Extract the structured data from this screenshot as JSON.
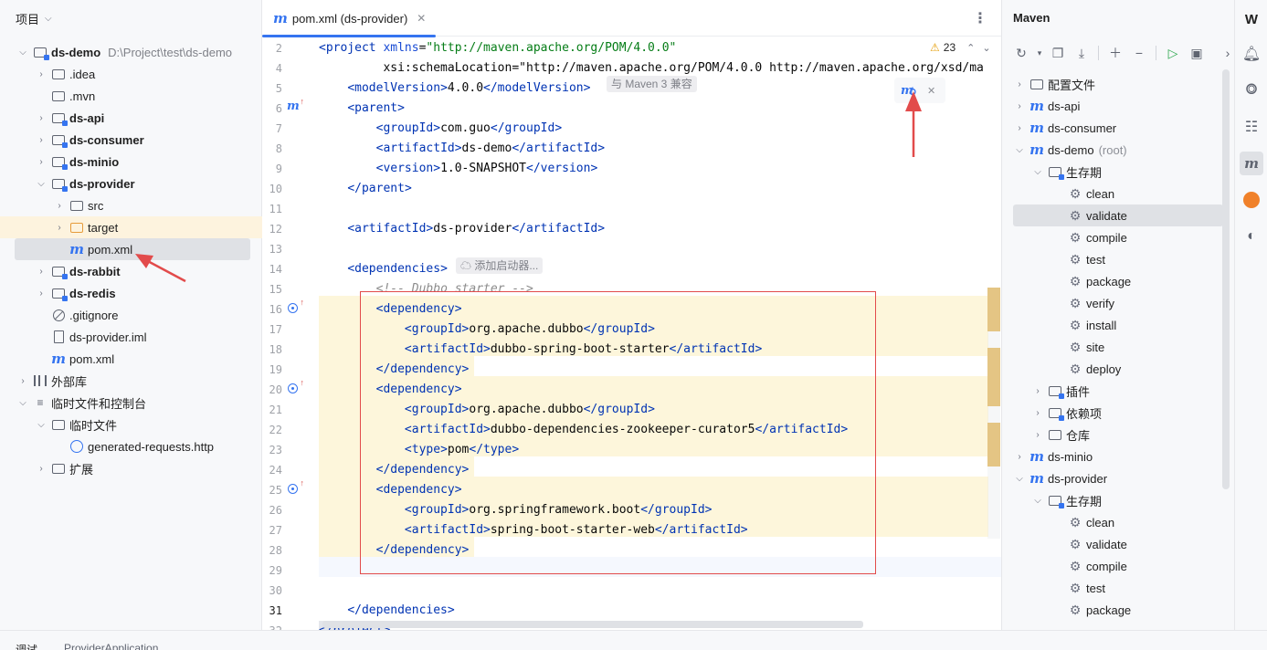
{
  "project_panel": {
    "title": "项目",
    "tree": [
      {
        "label": "ds-demo",
        "path": "D:\\Project\\test\\ds-demo",
        "bold": true,
        "expanded": true
      },
      {
        "label": ".idea"
      },
      {
        "label": ".mvn"
      },
      {
        "label": "ds-api",
        "bold": true
      },
      {
        "label": "ds-consumer",
        "bold": true
      },
      {
        "label": "ds-minio",
        "bold": true
      },
      {
        "label": "ds-provider",
        "bold": true,
        "expanded": true
      },
      {
        "label": "src"
      },
      {
        "label": "target"
      },
      {
        "label": "pom.xml"
      },
      {
        "label": "ds-rabbit",
        "bold": true
      },
      {
        "label": "ds-redis",
        "bold": true
      },
      {
        "label": ".gitignore"
      },
      {
        "label": "ds-provider.iml"
      },
      {
        "label": "pom.xml"
      },
      {
        "label": "外部库"
      },
      {
        "label": "临时文件和控制台"
      },
      {
        "label": "临时文件"
      },
      {
        "label": "generated-requests.http"
      },
      {
        "label": "扩展"
      }
    ]
  },
  "editor": {
    "tab_label": "pom.xml (ds-provider)",
    "warnings": "23",
    "hints": {
      "maven_compat": "与 Maven 3 兼容",
      "add_starter": "添加启动器..."
    },
    "lines": [
      {
        "n": "2",
        "t": "<project xmlns=\"http://maven.apache.org/POM/4.0.0\""
      },
      {
        "n": "4",
        "t": "         xsi:schemaLocation=\"http://maven.apache.org/POM/4.0.0 http://maven.apache.org/xsd/ma"
      },
      {
        "n": "5",
        "t": "    <modelVersion>4.0.0</modelVersion>"
      },
      {
        "n": "6",
        "t": "    <parent>"
      },
      {
        "n": "7",
        "t": "        <groupId>com.guo</groupId>"
      },
      {
        "n": "8",
        "t": "        <artifactId>ds-demo</artifactId>"
      },
      {
        "n": "9",
        "t": "        <version>1.0-SNAPSHOT</version>"
      },
      {
        "n": "10",
        "t": "    </parent>"
      },
      {
        "n": "11",
        "t": ""
      },
      {
        "n": "12",
        "t": "    <artifactId>ds-provider</artifactId>"
      },
      {
        "n": "13",
        "t": ""
      },
      {
        "n": "14",
        "t": "    <dependencies>"
      },
      {
        "n": "15",
        "t": "        <!-- Dubbo starter -->"
      },
      {
        "n": "16",
        "t": "        <dependency>"
      },
      {
        "n": "17",
        "t": "            <groupId>org.apache.dubbo</groupId>"
      },
      {
        "n": "18",
        "t": "            <artifactId>dubbo-spring-boot-starter</artifactId>"
      },
      {
        "n": "19",
        "t": "        </dependency>"
      },
      {
        "n": "20",
        "t": "        <dependency>"
      },
      {
        "n": "21",
        "t": "            <groupId>org.apache.dubbo</groupId>"
      },
      {
        "n": "22",
        "t": "            <artifactId>dubbo-dependencies-zookeeper-curator5</artifactId>"
      },
      {
        "n": "23",
        "t": "            <type>pom</type>"
      },
      {
        "n": "24",
        "t": "        </dependency>"
      },
      {
        "n": "25",
        "t": "        <dependency>"
      },
      {
        "n": "26",
        "t": "            <groupId>org.springframework.boot</groupId>"
      },
      {
        "n": "27",
        "t": "            <artifactId>spring-boot-starter-web</artifactId>"
      },
      {
        "n": "28",
        "t": "        </dependency>"
      },
      {
        "n": "29",
        "t": ""
      },
      {
        "n": "30",
        "t": ""
      },
      {
        "n": "31",
        "t": "    </dependencies>"
      },
      {
        "n": "32",
        "t": "</project>"
      }
    ]
  },
  "maven_panel": {
    "title": "Maven",
    "tree": [
      {
        "label": "配置文件"
      },
      {
        "label": "ds-api"
      },
      {
        "label": "ds-consumer"
      },
      {
        "label": "ds-demo",
        "suffix": "(root)"
      },
      {
        "label": "生存期"
      },
      {
        "label": "clean"
      },
      {
        "label": "validate"
      },
      {
        "label": "compile"
      },
      {
        "label": "test"
      },
      {
        "label": "package"
      },
      {
        "label": "verify"
      },
      {
        "label": "install"
      },
      {
        "label": "site"
      },
      {
        "label": "deploy"
      },
      {
        "label": "插件"
      },
      {
        "label": "依赖项"
      },
      {
        "label": "仓库"
      },
      {
        "label": "ds-minio"
      },
      {
        "label": "ds-provider"
      },
      {
        "label": "生存期"
      },
      {
        "label": "clean"
      },
      {
        "label": "validate"
      },
      {
        "label": "compile"
      },
      {
        "label": "test"
      },
      {
        "label": "package"
      }
    ]
  },
  "bottom": {
    "debug_label": "调试",
    "run_config": "ProviderApplication"
  },
  "colors": {
    "accent": "#3574f0",
    "annotation": "#e24b4b",
    "highlight": "#fdf6db"
  }
}
